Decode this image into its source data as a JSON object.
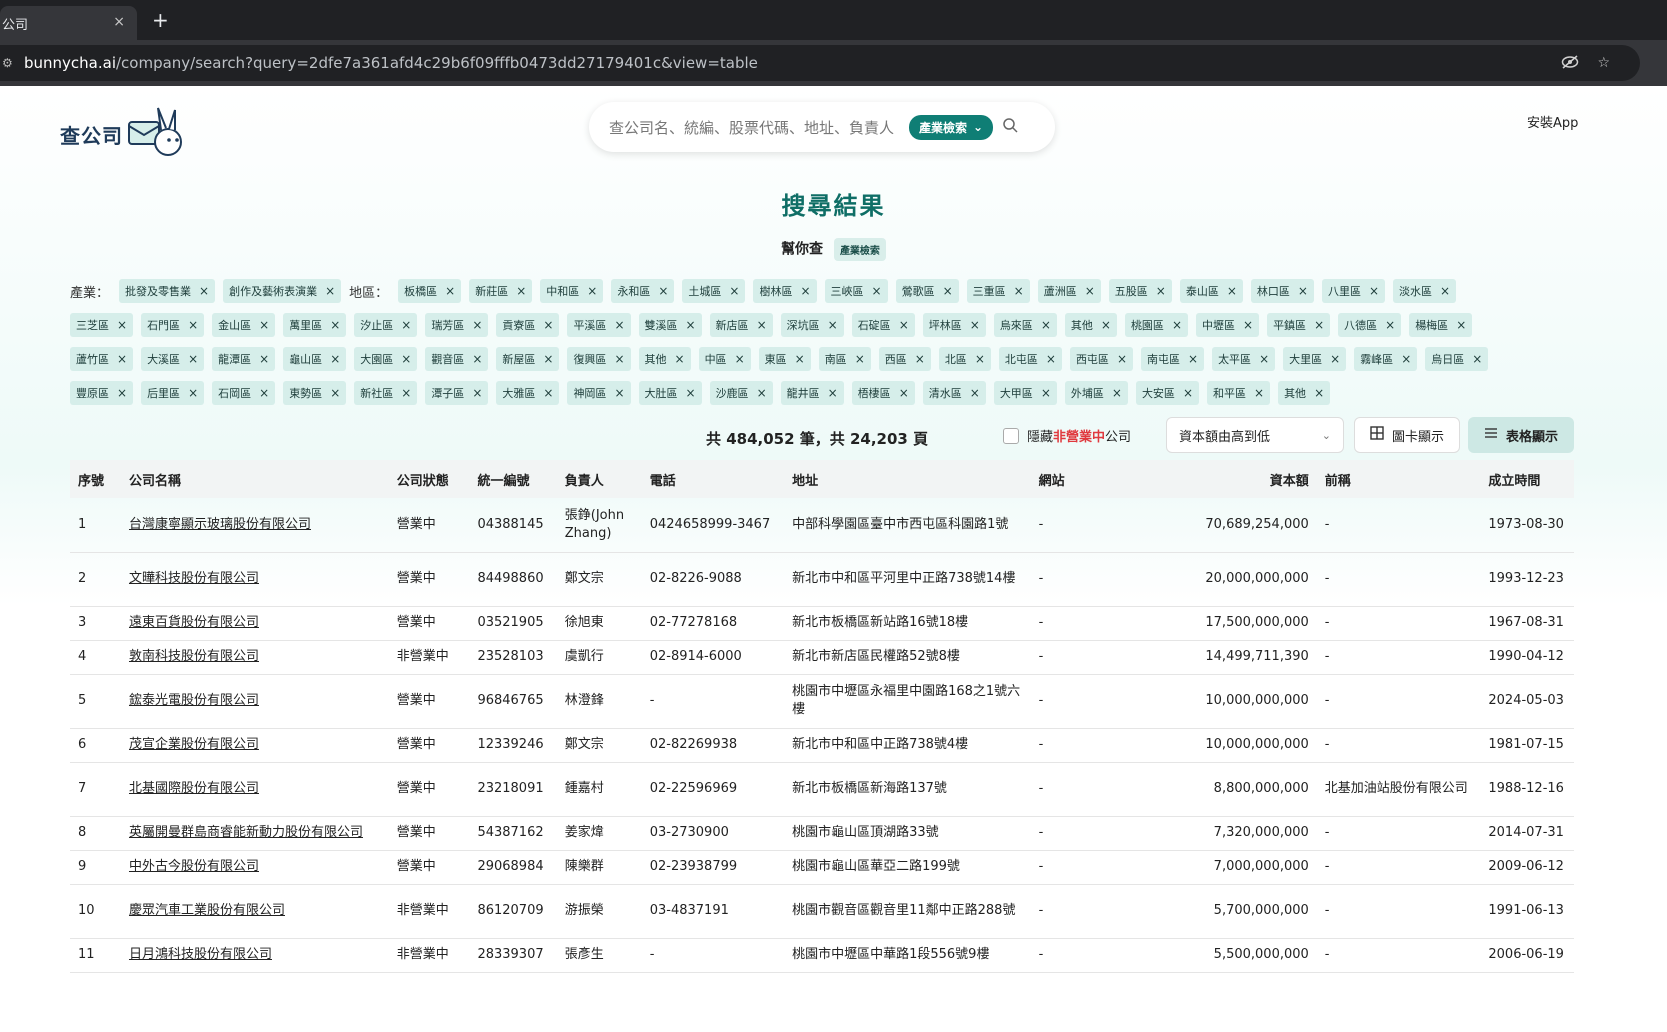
{
  "browser": {
    "tab_title": "公司",
    "tab_close": "×",
    "new_tab": "+",
    "url_host": "bunnycha.ai",
    "url_path": "/company/search?query=2dfe7a361afd4c29b6f09fffb0473dd27179401c&view=table"
  },
  "header": {
    "logo_text": "查公司",
    "search_placeholder": "查公司名、統編、股票代碼、地址、負責人",
    "industry_search_label": "產業檢索",
    "install_app": "安裝App"
  },
  "results": {
    "title": "搜尋結果",
    "helper_label": "幫你查",
    "helper_badge": "產業檢索",
    "industry_label": "產業：",
    "region_label": "地區：",
    "industries": [
      "批發及零售業",
      "創作及藝術表演業"
    ],
    "region_rows": [
      [
        "板橋區",
        "新莊區",
        "中和區",
        "永和區",
        "土城區",
        "樹林區",
        "三峽區",
        "鶯歌區",
        "三重區",
        "蘆洲區",
        "五股區",
        "泰山區",
        "林口區",
        "八里區",
        "淡水區"
      ],
      [
        "三芝區",
        "石門區",
        "金山區",
        "萬里區",
        "汐止區",
        "瑞芳區",
        "貢寮區",
        "平溪區",
        "雙溪區",
        "新店區",
        "深坑區",
        "石碇區",
        "坪林區",
        "烏來區",
        "其他",
        "桃園區",
        "中壢區",
        "平鎮區",
        "八德區",
        "楊梅區"
      ],
      [
        "蘆竹區",
        "大溪區",
        "龍潭區",
        "龜山區",
        "大園區",
        "觀音區",
        "新屋區",
        "復興區",
        "其他",
        "中區",
        "東區",
        "南區",
        "西區",
        "北區",
        "北屯區",
        "西屯區",
        "南屯區",
        "太平區",
        "大里區",
        "霧峰區",
        "烏日區"
      ],
      [
        "豐原區",
        "后里區",
        "石岡區",
        "東勢區",
        "新社區",
        "潭子區",
        "大雅區",
        "神岡區",
        "大肚區",
        "沙鹿區",
        "龍井區",
        "梧棲區",
        "清水區",
        "大甲區",
        "外埔區",
        "大安區",
        "和平區",
        "其他"
      ]
    ],
    "chip_close": "×",
    "summary": "共 484,052 筆，共 24,203 頁",
    "hide_prefix": "隱藏",
    "hide_red": "非營業中",
    "hide_suffix": "公司",
    "sort_value": "資本額由高到低",
    "card_view_label": "圖卡顯示",
    "table_view_label": "表格顯示"
  },
  "table": {
    "headers": [
      "序號",
      "公司名稱",
      "公司狀態",
      "統一編號",
      "負責人",
      "電話",
      "地址",
      "網站",
      "資本額",
      "前稱",
      "成立時間"
    ],
    "rows": [
      {
        "no": "1",
        "name": "台灣康寧顯示玻璃股份有限公司",
        "status": "營業中",
        "open": true,
        "id": "04388145",
        "owner": "張錚(John Zhang)",
        "phone": "0424658999-3467",
        "address": "中部科學園區臺中市西屯區科園路1號",
        "web": "-",
        "capital": "70,689,254,000",
        "former": "-",
        "founded": "1973-08-30"
      },
      {
        "no": "2",
        "name": "文曄科技股份有限公司",
        "status": "營業中",
        "open": true,
        "id": "84498860",
        "owner": "鄭文宗",
        "phone": "02-8226-9088",
        "address": "新北市中和區平河里中正路738號14樓",
        "web": "-",
        "capital": "20,000,000,000",
        "former": "-",
        "founded": "1993-12-23"
      },
      {
        "no": "3",
        "name": "遠東百貨股份有限公司",
        "status": "營業中",
        "open": true,
        "id": "03521905",
        "owner": "徐旭東",
        "phone": "02-77278168",
        "address": "新北市板橋區新站路16號18樓",
        "web": "-",
        "capital": "17,500,000,000",
        "former": "-",
        "founded": "1967-08-31"
      },
      {
        "no": "4",
        "name": "敦南科技股份有限公司",
        "status": "非營業中",
        "open": false,
        "id": "23528103",
        "owner": "虞凱行",
        "phone": "02-8914-6000",
        "address": "新北市新店區民權路52號8樓",
        "web": "-",
        "capital": "14,499,711,390",
        "former": "-",
        "founded": "1990-04-12"
      },
      {
        "no": "5",
        "name": "鋐泰光電股份有限公司",
        "status": "營業中",
        "open": true,
        "id": "96846765",
        "owner": "林澄鋒",
        "phone": "-",
        "address": "桃園市中壢區永福里中園路168之1號六樓",
        "web": "-",
        "capital": "10,000,000,000",
        "former": "-",
        "founded": "2024-05-03"
      },
      {
        "no": "6",
        "name": "茂宣企業股份有限公司",
        "status": "營業中",
        "open": true,
        "id": "12339246",
        "owner": "鄭文宗",
        "phone": "02-82269938",
        "address": "新北市中和區中正路738號4樓",
        "web": "-",
        "capital": "10,000,000,000",
        "former": "-",
        "founded": "1981-07-15"
      },
      {
        "no": "7",
        "name": "北基國際股份有限公司",
        "status": "營業中",
        "open": true,
        "id": "23218091",
        "owner": "鍾嘉村",
        "phone": "02-22596969",
        "address": "新北市板橋區新海路137號",
        "web": "-",
        "capital": "8,800,000,000",
        "former": "北基加油站股份有限公司",
        "founded": "1988-12-16"
      },
      {
        "no": "8",
        "name": "英屬開曼群島商睿能新動力股份有限公司",
        "status": "營業中",
        "open": true,
        "id": "54387162",
        "owner": "姜家煒",
        "phone": "03-2730900",
        "address": "桃園市龜山區頂湖路33號",
        "web": "-",
        "capital": "7,320,000,000",
        "former": "-",
        "founded": "2014-07-31"
      },
      {
        "no": "9",
        "name": "中外古今股份有限公司",
        "status": "營業中",
        "open": true,
        "id": "29068984",
        "owner": "陳樂群",
        "phone": "02-23938799",
        "address": "桃園市龜山區華亞二路199號",
        "web": "-",
        "capital": "7,000,000,000",
        "former": "-",
        "founded": "2009-06-12"
      },
      {
        "no": "10",
        "name": "慶眾汽車工業股份有限公司",
        "status": "非營業中",
        "open": false,
        "id": "86120709",
        "owner": "游振榮",
        "phone": "03-4837191",
        "address": "桃園市觀音區觀音里11鄰中正路288號",
        "web": "-",
        "capital": "5,700,000,000",
        "former": "-",
        "founded": "1991-06-13"
      },
      {
        "no": "11",
        "name": "日月鴻科技股份有限公司",
        "status": "非營業中",
        "open": false,
        "id": "28339307",
        "owner": "張彥生",
        "phone": "-",
        "address": "桃園市中壢區中華路1段556號9樓",
        "web": "-",
        "capital": "5,500,000,000",
        "former": "-",
        "founded": "2006-06-19"
      }
    ]
  },
  "colors": {
    "brand": "#0f7e75",
    "chip_bg": "#d6eeea",
    "status_open": "#3ea34a",
    "status_closed": "#e0393e"
  }
}
